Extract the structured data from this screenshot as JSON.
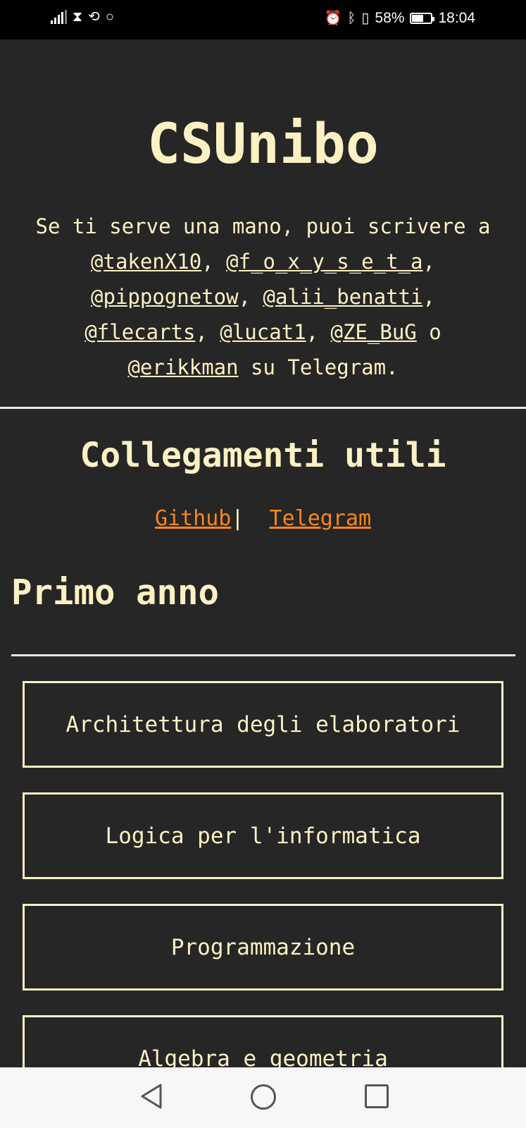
{
  "status_bar": {
    "battery": "58%",
    "time": "18:04",
    "battery_level": 0.58
  },
  "header": {
    "title": "CSUnibo",
    "intro_prefix": "Se ti serve una mano, puoi scrivere a",
    "handles": [
      "@takenX10",
      "@f_o_x_y_s_e_t_a",
      "@pippognetow",
      "@alii_benatti",
      "@flecarts",
      "@lucat1",
      "@ZE_BuG",
      "@erikkman"
    ],
    "conjunction": "o",
    "intro_suffix": "su Telegram."
  },
  "useful_links": {
    "title": "Collegamenti utili",
    "github": "Github",
    "separator": "|",
    "telegram": "Telegram"
  },
  "year": {
    "title": "Primo anno",
    "courses": [
      "Architettura degli elaboratori",
      "Logica per l'informatica",
      "Programmazione",
      "Algebra e geometria"
    ]
  }
}
